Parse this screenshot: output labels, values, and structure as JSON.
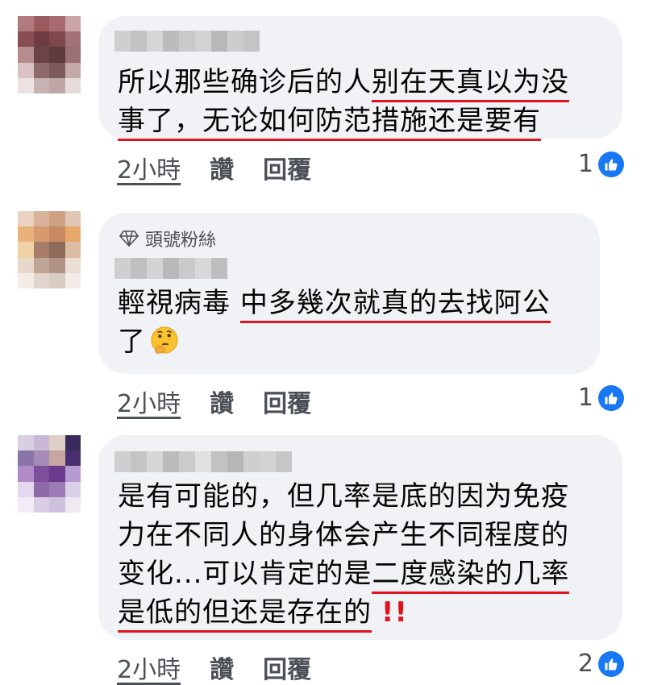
{
  "comments": [
    {
      "badge": "",
      "lines": [
        {
          "pre": "所以那些确诊后的人",
          "ul": "别在天真以为没",
          "post": ""
        },
        {
          "pre": "",
          "ul": "事了，无论如何防范措施还是要有",
          "post": ""
        }
      ],
      "time": "2小時",
      "like_label": "讚",
      "reply_label": "回覆",
      "reaction_count": "1"
    },
    {
      "badge": "頭號粉絲",
      "lines": [
        {
          "pre": "輕視病毒 ",
          "ul": "中多幾次就真的去找阿公",
          "post": ""
        },
        {
          "pre": "了",
          "ul": "",
          "post": ""
        }
      ],
      "time": "2小時",
      "like_label": "讚",
      "reply_label": "回覆",
      "reaction_count": "1"
    },
    {
      "badge": "",
      "lines": [
        {
          "pre": "是有可能的，但几率是底的因为免疫",
          "ul": "",
          "post": ""
        },
        {
          "pre": "力在不同人的身体会产生不同程度的",
          "ul": "",
          "post": ""
        },
        {
          "pre": "变化...可以肯定的是",
          "ul": "二度感染的几率",
          "post": ""
        },
        {
          "pre": "",
          "ul": "是低的但还是存在的",
          "post": ""
        }
      ],
      "exclaim": "!!",
      "time": "2小時",
      "like_label": "讚",
      "reply_label": "回覆",
      "reaction_count": "2"
    }
  ],
  "icons": {
    "reaction": "like-thumbs-up-icon",
    "badge": "diamond-icon",
    "emoji": "thinking-face-emoji"
  },
  "colors": {
    "bubble": "#f0f2f5",
    "underline": "#e0141e",
    "like": "#1877f2"
  }
}
